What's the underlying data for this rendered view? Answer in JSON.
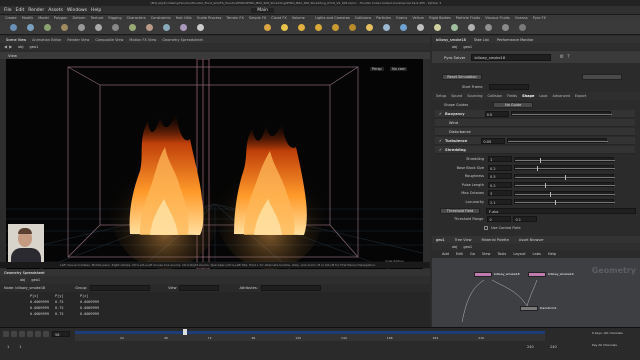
{
  "window": {
    "title": "{B3}(A)(Z):Udemy/Houdini/Houdini_Fluid_Sim/FS_Houdini/PYRO/PYRO_B02_SIM_Shredding/PYRO_B02_SIM_Shredding_0716_V2_001.hipnc - Houdini Indie Limited-Commercial 19.0.455 - Python 3"
  },
  "menubar": {
    "items": [
      "File",
      "Edit",
      "Render",
      "Assets",
      "Windows",
      "Help"
    ],
    "desktop": "Main"
  },
  "shelf_tabs": {
    "left": [
      "Create",
      "Modify",
      "Model",
      "Polygon",
      "Deform",
      "Texture",
      "Rigging",
      "Characters",
      "Constraints",
      "Hair Utils",
      "Guide Process",
      "Terrain FX",
      "Simple FX",
      "Cloud FX",
      "Volume"
    ],
    "right": [
      "Lights and Cameras",
      "Collisions",
      "Particles",
      "Grains",
      "Vellum",
      "Rigid Bodies",
      "Particle Fluids",
      "Viscous Fluids",
      "Oceans",
      "Pyro FX",
      "FEM",
      "Wires",
      "Crowds",
      "Drive Simulation"
    ]
  },
  "left_pane": {
    "tabs": [
      "Scene View",
      "Animation Editor",
      "Render View",
      "Composite View",
      "Motion FX View",
      "Geometry Spreadsheet"
    ],
    "path": [
      "obj",
      "geo1"
    ],
    "view_label": "View",
    "persp_label": "Persp",
    "cam_label": "No cam",
    "status_text": "Left mouse tumbles. Middle pans. Right dollies. Ctrl+Alt+Left mouse box-zooms. Ctrl+Right zooms. Spacebar+Ctrl+Left tilts. Hold L for alternate tumble, dolly, and zoom.   M or Alt+M for First Person Navigation.",
    "indie_label": "Indie Edition"
  },
  "spreadsheet": {
    "tabs": [
      "Geometry Spreadsheet"
    ],
    "path": [
      "obj",
      "geo1"
    ],
    "node_label": "Node: billowy_smoke18",
    "group_label": "Group:",
    "view_label": "View",
    "attributes_label": "Attributes:",
    "columns": [
      "P[x]",
      "P[y]",
      "P[z]"
    ],
    "rows": [
      [
        "0.0009999",
        "0.75",
        "0.0009999"
      ],
      [
        "0.0009999",
        "0.75",
        "0.0009999"
      ],
      [
        "0.0009999",
        "0.75",
        "0.0009999"
      ]
    ]
  },
  "timeline": {
    "current_frame": "58",
    "start": "1",
    "end": "240",
    "end2": "240",
    "keys_label": "0 keys, 0/0 channels",
    "key_all_label": "Key All Channels",
    "playhead_fraction": 0.23,
    "ticks": [
      "24",
      "48",
      "72",
      "96",
      "120",
      "144",
      "168",
      "192",
      "216"
    ]
  },
  "params": {
    "tabs": [
      "billowy_smoke18",
      "Take List",
      "Performance Monitor"
    ],
    "path": [
      "obj",
      "geo1"
    ],
    "node_type": "Pyro Solver",
    "node_name": "billowy_smoke18",
    "reset_label": "Reset Simulation",
    "cache_label": "Start Frame",
    "tabs2": [
      "Setup",
      "Sound",
      "Sourcing",
      "Collision",
      "Fields",
      "Shape",
      "Look",
      "Advanced",
      "Export"
    ],
    "active_tab": "Shape",
    "shape_guides_label": "Shape Guides",
    "shape_guides_value": "No Guide",
    "buoyancy_label": "Buoyancy",
    "buoyancy_value": "0.5",
    "wind_label": "Wind",
    "disturbance_label": "Disturbance",
    "turbulence_label": "Turbulence",
    "turbulence_value": "0.05",
    "shredding_label": "Shredding",
    "shredding": [
      {
        "label": "Shredding",
        "value": "1",
        "fill": 0.25
      },
      {
        "label": "Base Block Size",
        "value": "0.2",
        "fill": 0.22
      },
      {
        "label": "Roughness",
        "value": "0.5",
        "fill": 0.5
      },
      {
        "label": "Pulse Length",
        "value": "0.2",
        "fill": 0.3
      },
      {
        "label": "Max Octaves",
        "value": "3",
        "fill": 0.35
      },
      {
        "label": "Lacunarity",
        "value": "2.1",
        "fill": 0.4
      }
    ],
    "mask_label": "Threshold Field",
    "mask_value": "F-abs",
    "threshold_label": "Threshold Range",
    "threshold_value": "0",
    "threshold_value2": "0.1",
    "control_field_label": "Use Control Field"
  },
  "network": {
    "tabs": [
      "geo1",
      "Tree View",
      "Material Palette",
      "Asset Browser"
    ],
    "path": [
      "obj",
      "geo1"
    ],
    "menu": [
      "Add",
      "Edit",
      "Go",
      "View",
      "Tools",
      "Layout",
      "Labs",
      "Help"
    ],
    "context_label": "Geometry",
    "nodes": [
      {
        "label": "billowy_smoke18"
      },
      {
        "label": "billowy_smoke19"
      },
      {
        "label": "transform1"
      }
    ]
  },
  "colors": {
    "fire_core": "#ffd07a",
    "fire_mid": "#f07a1a",
    "fire_edge": "#8a2a05",
    "timeline_blue": "#1e3c78"
  }
}
